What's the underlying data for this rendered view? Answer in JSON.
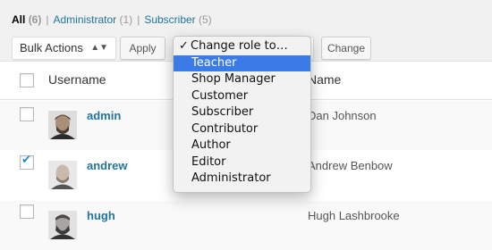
{
  "filters": {
    "all_label": "All",
    "all_count": "(6)",
    "separator": "|",
    "items": [
      {
        "label": "Administrator",
        "count": "(1)"
      },
      {
        "label": "Subscriber",
        "count": "(5)"
      }
    ]
  },
  "toolbar": {
    "bulk_actions_value": "Bulk Actions",
    "bulk_actions_arrows": "▲▼",
    "apply_label": "Apply",
    "change_label": "Change"
  },
  "role_menu": {
    "check_glyph": "✓",
    "selected_label": "Change role to…",
    "options": [
      "Teacher",
      "Shop Manager",
      "Customer",
      "Subscriber",
      "Contributor",
      "Author",
      "Editor",
      "Administrator"
    ],
    "highlighted_option": "Teacher",
    "highlight_color": "#3b7be5"
  },
  "table": {
    "headers": {
      "username": "Username",
      "name": "Name"
    },
    "rows": [
      {
        "username": "admin",
        "name": "Dan Johnson",
        "checked": false,
        "avatar": "user-photo"
      },
      {
        "username": "andrew",
        "name": "Andrew Benbow",
        "checked": true,
        "avatar": "user-photo"
      },
      {
        "username": "hugh",
        "name": "Hugh Lashbrooke",
        "checked": false,
        "avatar": "user-photo"
      }
    ]
  },
  "colors": {
    "link": "#21759b",
    "checkbox_check": "#1e8cbe",
    "page_bg": "#f1f1f1"
  }
}
